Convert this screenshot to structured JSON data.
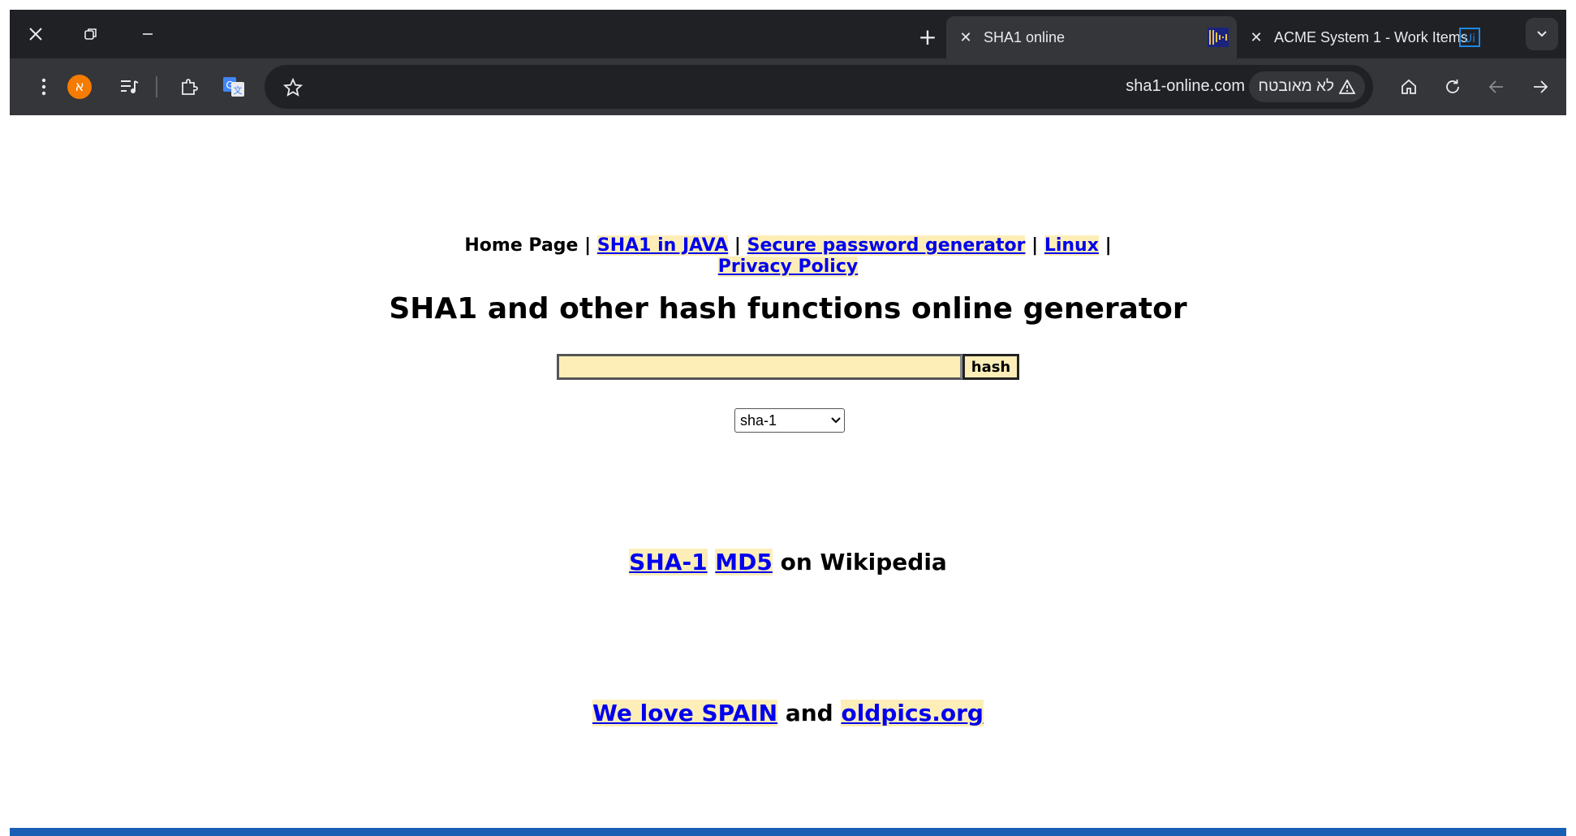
{
  "browser": {
    "tabs": [
      {
        "title": "SHA1 online",
        "active": true
      },
      {
        "title": "ACME System 1 - Work Items",
        "active": false
      }
    ],
    "profile_initial": "א",
    "url": "sha1-online.com",
    "security_label": "לא מאובטח"
  },
  "page": {
    "nav": {
      "home": "Home Page",
      "sep": "|",
      "links": [
        "SHA1 in JAVA",
        "Secure password generator",
        "Linux",
        "Privacy Policy"
      ]
    },
    "title": "SHA1 and other hash functions online generator",
    "input": {
      "value": "",
      "button": "hash"
    },
    "algorithm": {
      "selected": "sha-1"
    },
    "wiki": {
      "link1": "SHA-1",
      "link2": "MD5",
      "suffix": "on Wikipedia"
    },
    "footer": {
      "link1": "We love SPAIN",
      "and": "and",
      "link2": "oldpics.org"
    }
  },
  "colors": {
    "link": "#0000ee",
    "highlight": "#fdeeb8",
    "chrome_dark": "#202124",
    "chrome_mid": "#35363a"
  }
}
